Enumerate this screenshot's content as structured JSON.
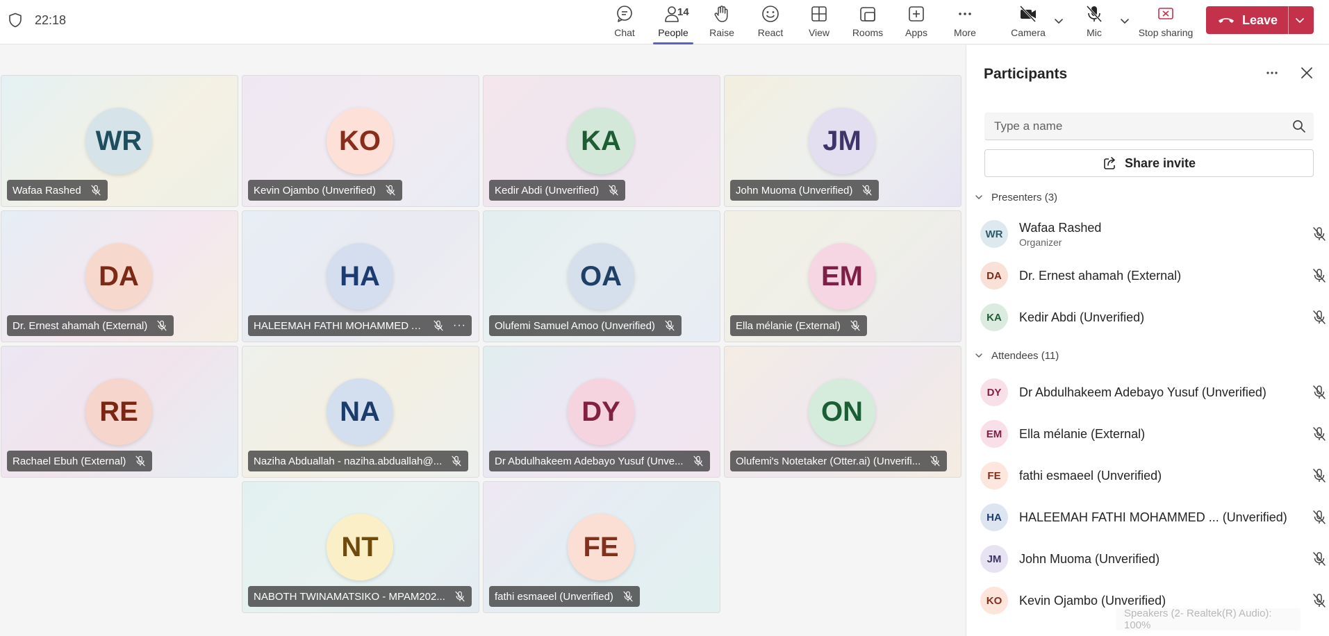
{
  "topbar": {
    "timer": "22:18",
    "people_count": "14",
    "buttons": {
      "chat": "Chat",
      "people": "People",
      "raise": "Raise",
      "react": "React",
      "view": "View",
      "rooms": "Rooms",
      "apps": "Apps",
      "more": "More",
      "camera": "Camera",
      "mic": "Mic",
      "stop_sharing": "Stop sharing"
    },
    "leave": "Leave",
    "accent_color": "#5b5fc7",
    "leave_color": "#c4314b"
  },
  "tiles": [
    {
      "initials": "WR",
      "name": "Wafaa Rashed",
      "avatar_bg": "#d6e4ea",
      "avatar_fg": "#1f4e5f",
      "tile_bg": "linear-gradient(135deg,#e4f1f4,#f4f1e4 60%,#eef0e6)",
      "more": false
    },
    {
      "initials": "KO",
      "name": "Kevin Ojambo (Unverified)",
      "avatar_bg": "#fde0d7",
      "avatar_fg": "#8a2c1b",
      "tile_bg": "linear-gradient(135deg,#efe8f3,#f2eaf1 50%,#e9ecf5)",
      "more": false
    },
    {
      "initials": "KA",
      "name": "Kedir Abdi (Unverified)",
      "avatar_bg": "#d3e8d9",
      "avatar_fg": "#1e5c33",
      "tile_bg": "linear-gradient(135deg,#f4e6ec,#efe6f0 55%,#f2e7ef)",
      "more": false
    },
    {
      "initials": "JM",
      "name": "John Muoma (Unverified)",
      "avatar_bg": "#e3def0",
      "avatar_fg": "#3f3468",
      "tile_bg": "linear-gradient(135deg,#f3efdf,#eef0ee 50%,#e6e4f3)",
      "more": false
    },
    {
      "initials": "DA",
      "name": "Dr. Ernest ahamah (External)",
      "avatar_bg": "#f7d8cd",
      "avatar_fg": "#7a2a15",
      "tile_bg": "linear-gradient(135deg,#e6eef5,#f4e7ef 55%,#f4eee2)",
      "more": false
    },
    {
      "initials": "HA",
      "name": "HALEEMAH FATHI MOHAMMED A...",
      "avatar_bg": "#d4deee",
      "avatar_fg": "#1c3b6e",
      "tile_bg": "linear-gradient(135deg,#e8eef5,#e9eaf2 50%,#eeeef3)",
      "more": true
    },
    {
      "initials": "OA",
      "name": "Olufemi Samuel Amoo (Unverified)",
      "avatar_bg": "#d6e0ec",
      "avatar_fg": "#203f66",
      "tile_bg": "linear-gradient(135deg,#e3eef0,#eaf0f1 50%,#e8ecf4)",
      "more": false
    },
    {
      "initials": "EM",
      "name": "Ella mélanie (External)",
      "avatar_bg": "#f5d6e2",
      "avatar_fg": "#7d1f47",
      "tile_bg": "linear-gradient(135deg,#f2f0e6,#efefe8 50%,#ece9ee)",
      "more": false
    },
    {
      "initials": "RE",
      "name": "Rachael Ebuh (External)",
      "avatar_bg": "#f5d5cc",
      "avatar_fg": "#7a2612",
      "tile_bg": "linear-gradient(135deg,#ece7f3,#f1e4ec 50%,#e6eef4)",
      "more": false
    },
    {
      "initials": "NA",
      "name": "Naziha Abduallah - naziha.abduallah@...",
      "avatar_bg": "#d3dfee",
      "avatar_fg": "#1b3c6a",
      "tile_bg": "linear-gradient(135deg,#eef1ec,#f3efe3 50%,#edf0ee)",
      "more": false
    },
    {
      "initials": "DY",
      "name": "Dr Abdulhakeem Adebayo Yusuf (Unve...",
      "avatar_bg": "#f5d4e0",
      "avatar_fg": "#82203f",
      "tile_bg": "linear-gradient(135deg,#e0eef0,#eee6f3 50%,#f2e5ef)",
      "more": false
    },
    {
      "initials": "ON",
      "name": "Olufemi's Notetaker (Otter.ai) (Unverifi...",
      "avatar_bg": "#d5ecdd",
      "avatar_fg": "#1b5e35",
      "tile_bg": "linear-gradient(135deg,#f4ece4,#efe8ee 50%,#f4ece1)",
      "more": false
    },
    {
      "initials": "NT",
      "name": "NABOTH TWINAMATSIKO - MPAM202...",
      "avatar_bg": "#fbefc8",
      "avatar_fg": "#6e4a0d",
      "tile_bg": "linear-gradient(135deg,#e2f1f0,#e8f2f0 50%,#e4ecf2)",
      "more": false
    },
    {
      "initials": "FE",
      "name": "fathi esmaeel (Unverified)",
      "avatar_bg": "#fbded4",
      "avatar_fg": "#80301b",
      "tile_bg": "linear-gradient(135deg,#eee8f3,#e4eef3 50%,#e2f0ef)",
      "more": false
    }
  ],
  "panel": {
    "title": "Participants",
    "search_placeholder": "Type a name",
    "share_invite": "Share invite",
    "presenters_header": "Presenters (3)",
    "attendees_header": "Attendees (11)",
    "presenters": [
      {
        "initials": "WR",
        "name": "Wafaa Rashed",
        "role": "Organizer",
        "bg": "#dde9ee",
        "fg": "#2b5a6b"
      },
      {
        "initials": "DA",
        "name": "Dr. Ernest ahamah (External)",
        "role": "",
        "bg": "#f9e1d8",
        "fg": "#7a2a15"
      },
      {
        "initials": "KA",
        "name": "Kedir Abdi (Unverified)",
        "role": "",
        "bg": "#dcebdf",
        "fg": "#1e5c33"
      }
    ],
    "attendees": [
      {
        "initials": "DY",
        "name": "Dr Abdulhakeem Adebayo Yusuf (Unverified)",
        "bg": "#f8e0e8",
        "fg": "#82203f"
      },
      {
        "initials": "EM",
        "name": "Ella mélanie (External)",
        "bg": "#f8dfe8",
        "fg": "#7d1f47"
      },
      {
        "initials": "FE",
        "name": "fathi esmaeel (Unverified)",
        "bg": "#fce6de",
        "fg": "#80301b"
      },
      {
        "initials": "HA",
        "name": "HALEEMAH FATHI MOHAMMED ...  (Unverified)",
        "bg": "#dde5f1",
        "fg": "#1c3b6e"
      },
      {
        "initials": "JM",
        "name": "John Muoma (Unverified)",
        "bg": "#e8e3f2",
        "fg": "#3f3468"
      },
      {
        "initials": "KO",
        "name": "Kevin Ojambo (Unverified)",
        "bg": "#fde5dc",
        "fg": "#8a2c1b"
      }
    ]
  },
  "toast": "Speakers (2- Realtek(R) Audio): 100%"
}
